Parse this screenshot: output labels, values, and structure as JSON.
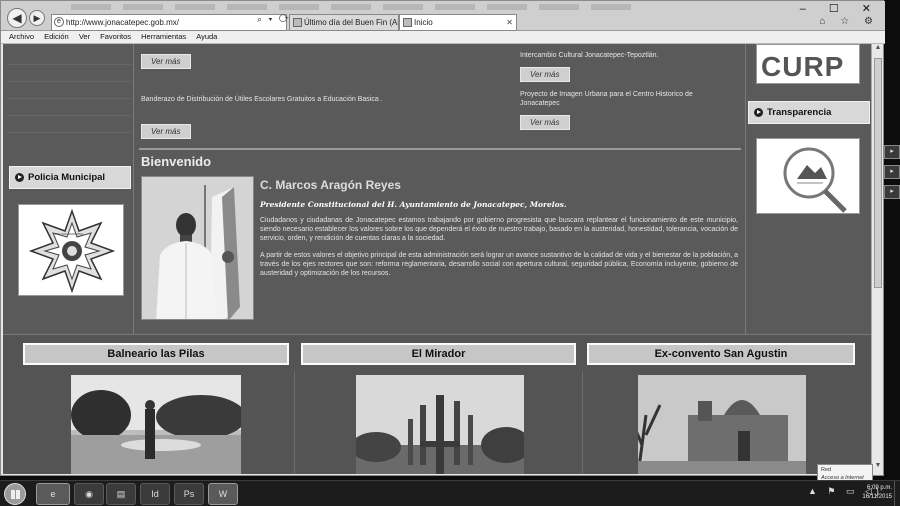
{
  "browser": {
    "address": "http://www.jonacatepec.gob.mx/",
    "address_tools": "⌕ ▾ ⟳ ✕",
    "tabs": [
      {
        "label": "Último día del Buen Fin (Aprov..."
      },
      {
        "label": "Inicio"
      }
    ],
    "window_controls": "– ☐ ✕",
    "right_icons": "⌂ ☆ ⚙"
  },
  "menubar": {
    "items": [
      "Archivo",
      "Edición",
      "Ver",
      "Favoritos",
      "Herramientas",
      "Ayuda"
    ]
  },
  "news": {
    "left_button_top": "Ver más",
    "left_text": "Banderazo de Distribución de Útiles Escolares Gratuitos a Educación Basica .",
    "left_button_bottom": "Ver más",
    "right_text_top": "Intercambio Cultural Jonacatepec-Tepoztlán.",
    "right_button_top": "Ver más",
    "right_text_bottom_1": "Proyecto de Imagen Urbana para el Centro Historico de",
    "right_text_bottom_2": "Jonacatepec",
    "right_button_bottom": "Ver más"
  },
  "welcome": {
    "heading": "Bienvenido",
    "name": "C. Marcos Aragón Reyes",
    "role": "Presidente Constitucional del H. Ayuntamiento de Jonacatepec, Morelos.",
    "paragraph1": "Ciudadanos y ciudadanas de Jonacatepec estamos trabajando por gobierno progresista que buscara replantear el funcionamiento de este municipio, siendo necesario establecer los valores sobre los que dependerá el éxito de nuestro trabajo, basado en la austeridad, honestidad, tolerancia, vocación de servicio, orden, y rendición de cuentas claras a la sociedad.",
    "paragraph2": "A partir de estos valores el objetivo principal de esta administración será lograr un avance sustantivo de la calidad de vida y el bienestar de la población, a través de los ejes rectores que son: reforma reglamentaria, desarrollo social con apertura cultural, seguridad pública, Economía incluyente, gobierno de austeridad y optimización de los recursos."
  },
  "sidebar_left": {
    "police_label": "Policia Municipal",
    "badge_text": "POLICIA MUNICIPAL"
  },
  "sidebar_right": {
    "curp_label": "CURP",
    "transparency_label": "Transparencia"
  },
  "gallery": {
    "items": [
      {
        "title": "Balneario las Pilas"
      },
      {
        "title": "El Mirador"
      },
      {
        "title": "Ex-convento San Agustin"
      }
    ]
  },
  "tooltip": {
    "line1": "Red",
    "line2": "Acceso a Internet"
  },
  "taskbar": {
    "apps": [
      {
        "label": "e"
      },
      {
        "label": "◉"
      },
      {
        "label": "▤"
      },
      {
        "label": "Id"
      },
      {
        "label": "Ps"
      },
      {
        "label": "W"
      }
    ],
    "tray_icons": "▲ ⚑ ▭ ◁)",
    "time": "6:09 p.m.",
    "date": "16/11/2015"
  }
}
